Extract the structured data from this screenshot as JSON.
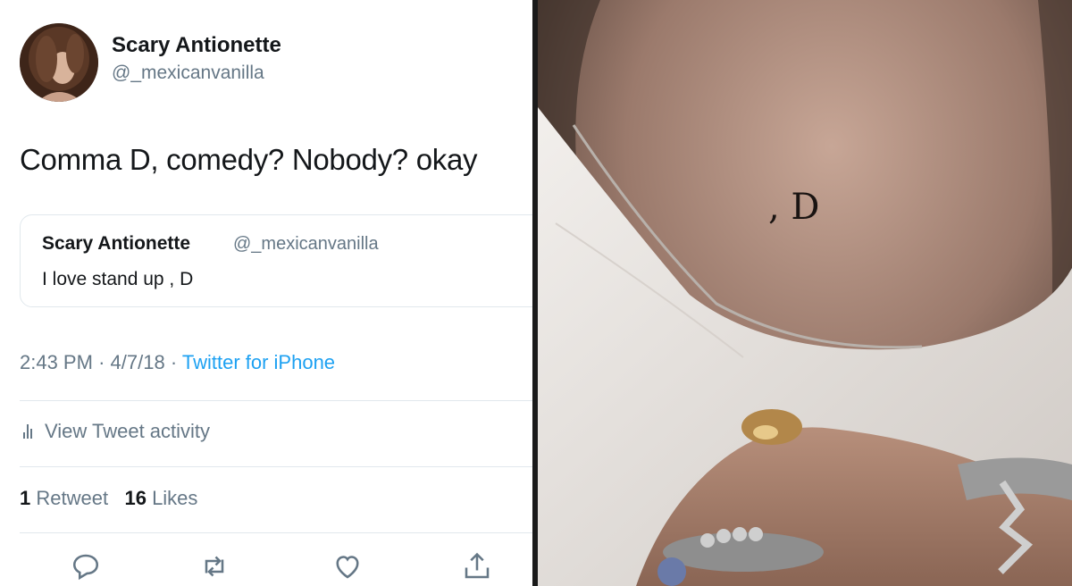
{
  "tweet": {
    "author_name": "Scary Antionette",
    "author_handle": "@_mexicanvanilla",
    "text": "Comma D, comedy? Nobody? okay",
    "quoted": {
      "author_name": "Scary Antionette",
      "author_handle": "@_mexicanvanilla",
      "text": "I love stand up , D"
    },
    "time": "2:43 PM",
    "date": "4/7/18",
    "source": "Twitter for iPhone",
    "activity_label": "View Tweet activity",
    "retweet_count": "1",
    "retweet_label": "Retweet",
    "like_count": "16",
    "like_label": "Likes"
  },
  "photo": {
    "tattoo_text": ", D"
  },
  "actions": {
    "icons": [
      "reply-icon",
      "retweet-icon",
      "like-icon",
      "share-icon"
    ]
  },
  "colors": {
    "accent": "#1da1f2",
    "text": "#14171a",
    "secondary": "#657786"
  }
}
